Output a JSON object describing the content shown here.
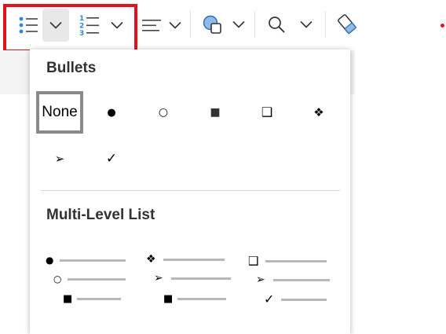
{
  "toolbar": {
    "buttons": [
      {
        "name": "bullets-button",
        "icon": "bulleted-list-icon"
      },
      {
        "name": "bullets-dropdown",
        "icon": "chevron-down-icon"
      },
      {
        "name": "numbering-button",
        "icon": "numbered-list-icon",
        "digits": [
          "1",
          "2",
          "3"
        ]
      },
      {
        "name": "numbering-dropdown",
        "icon": "chevron-down-icon"
      },
      {
        "name": "align-button",
        "icon": "align-left-icon"
      },
      {
        "name": "shapes-button",
        "icon": "shapes-icon"
      },
      {
        "name": "find-button",
        "icon": "search-icon"
      },
      {
        "name": "styles-button",
        "icon": "eraser-icon"
      }
    ],
    "accent_color": "#2b88d8",
    "highlight_color": "#e0121a"
  },
  "bullets_menu": {
    "section_title": "Bullets",
    "items": [
      {
        "label": "None",
        "selected": true
      },
      {
        "symbol": "●",
        "icon": "filled-circle-icon"
      },
      {
        "symbol": "○",
        "icon": "hollow-circle-icon"
      },
      {
        "symbol": "■",
        "icon": "filled-square-icon"
      },
      {
        "symbol": "❑",
        "icon": "shadowed-square-icon"
      },
      {
        "symbol": "❖",
        "icon": "diamond-icon"
      },
      {
        "symbol": "➢",
        "icon": "arrowhead-icon"
      },
      {
        "symbol": "✓",
        "icon": "checkmark-icon"
      }
    ]
  },
  "multilevel_menu": {
    "section_title": "Multi-Level List",
    "items": [
      {
        "levels": [
          "●",
          "○",
          "■"
        ]
      },
      {
        "levels": [
          "❖",
          "➢",
          "■"
        ]
      },
      {
        "levels": [
          "❑",
          "➢",
          "✓"
        ]
      }
    ]
  }
}
